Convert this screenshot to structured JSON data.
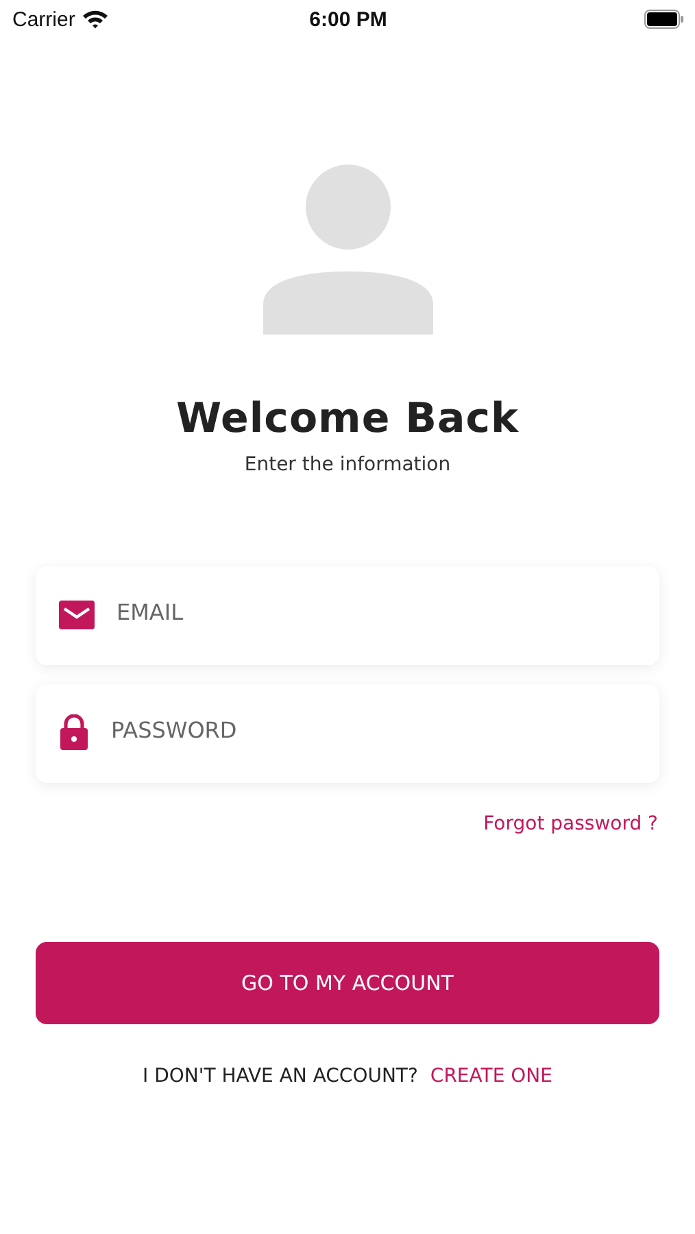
{
  "status_bar": {
    "carrier": "Carrier",
    "time": "6:00 PM"
  },
  "title": "Welcome Back",
  "subtitle": "Enter the information",
  "fields": [
    {
      "kind": "email",
      "placeholder": "EMAIL"
    },
    {
      "kind": "password",
      "placeholder": "PASSWORD"
    }
  ],
  "forgot_link": "Forgot password ?",
  "submit_button": "GO TO MY ACCOUNT",
  "signup": {
    "prompt": "I DON'T HAVE AN ACCOUNT?",
    "link": "CREATE ONE"
  }
}
